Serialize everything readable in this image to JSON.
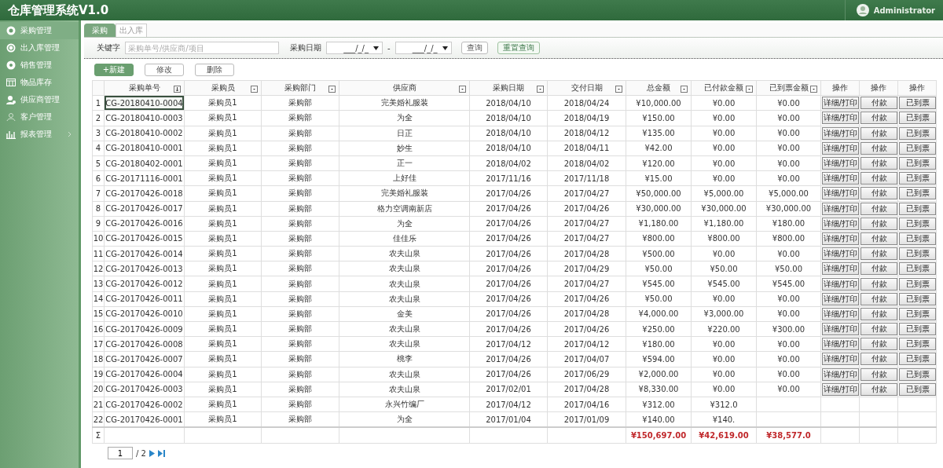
{
  "header": {
    "title": "仓库管理系统V1.0",
    "user": "Administrator"
  },
  "sidebar": {
    "items": [
      {
        "label": "采购管理",
        "selected": true
      },
      {
        "label": "出入库管理",
        "selected": false
      },
      {
        "label": "销售管理",
        "selected": false
      },
      {
        "label": "物品库存",
        "selected": false
      },
      {
        "label": "供应商管理",
        "selected": false
      },
      {
        "label": "客户管理",
        "selected": false
      },
      {
        "label": "报表管理",
        "selected": false,
        "expandable": true
      }
    ]
  },
  "tabs": [
    {
      "label": "采购",
      "selected": true
    },
    {
      "label": "出入库",
      "selected": false
    }
  ],
  "filters": {
    "keyword_label": "关键字",
    "keyword_placeholder": "采购单号/供应商/项目",
    "date_label": "采购日期",
    "date_from": "___/_/_",
    "separator": "-",
    "date_to": "___/_/_",
    "buttons": [
      "查询",
      "重置查询"
    ]
  },
  "toolbar": [
    {
      "label": "+新建",
      "kind": "primary"
    },
    {
      "label": "修改",
      "kind": "plain"
    },
    {
      "label": "删除",
      "kind": "plain"
    }
  ],
  "table": {
    "columns": [
      {
        "label": "采购单号",
        "kind": "sort"
      },
      {
        "label": "采购员",
        "kind": "filter"
      },
      {
        "label": "采购部门",
        "kind": "filter"
      },
      {
        "label": "供应商",
        "kind": "filter"
      },
      {
        "label": "采购日期",
        "kind": "filter"
      },
      {
        "label": "交付日期",
        "kind": "filter"
      },
      {
        "label": "总金额",
        "kind": "filter"
      },
      {
        "label": "已付款金额",
        "kind": "filter"
      },
      {
        "label": "已到票金额",
        "kind": "filter"
      },
      {
        "label": "操作",
        "kind": "plain"
      },
      {
        "label": "操作",
        "kind": "plain"
      },
      {
        "label": "操作",
        "kind": "plain"
      }
    ],
    "rows": [
      {
        "n": "1",
        "selected": true,
        "cells": [
          "CG-20180410-0004",
          "采购员1",
          "采购部",
          "完美婚礼服装",
          "2018/04/10",
          "2018/04/24",
          "¥10,000.00",
          "¥0.00",
          "¥0.00"
        ],
        "actions": [
          "详细/打印",
          "付款",
          "已到票"
        ]
      },
      {
        "n": "2",
        "selected": false,
        "cells": [
          "CG-20180410-0003",
          "采购员1",
          "采购部",
          "为全",
          "2018/04/10",
          "2018/04/19",
          "¥150.00",
          "¥0.00",
          "¥0.00"
        ],
        "actions": [
          "详细/打印",
          "付款",
          "已到票"
        ]
      },
      {
        "n": "3",
        "selected": false,
        "cells": [
          "CG-20180410-0002",
          "采购员1",
          "采购部",
          "日正",
          "2018/04/10",
          "2018/04/12",
          "¥135.00",
          "¥0.00",
          "¥0.00"
        ],
        "actions": [
          "详细/打印",
          "付款",
          "已到票"
        ]
      },
      {
        "n": "4",
        "selected": false,
        "cells": [
          "CG-20180410-0001",
          "采购员1",
          "采购部",
          "妙生",
          "2018/04/10",
          "2018/04/11",
          "¥42.00",
          "¥0.00",
          "¥0.00"
        ],
        "actions": [
          "详细/打印",
          "付款",
          "已到票"
        ]
      },
      {
        "n": "5",
        "selected": false,
        "cells": [
          "CG-20180402-0001",
          "采购员1",
          "采购部",
          "正一",
          "2018/04/02",
          "2018/04/02",
          "¥120.00",
          "¥0.00",
          "¥0.00"
        ],
        "actions": [
          "详细/打印",
          "付款",
          "已到票"
        ]
      },
      {
        "n": "6",
        "selected": false,
        "cells": [
          "CG-20171116-0001",
          "采购员1",
          "采购部",
          "上好佳",
          "2017/11/16",
          "2017/11/18",
          "¥15.00",
          "¥0.00",
          "¥0.00"
        ],
        "actions": [
          "详细/打印",
          "付款",
          "已到票"
        ]
      },
      {
        "n": "7",
        "selected": false,
        "cells": [
          "CG-20170426-0018",
          "采购员1",
          "采购部",
          "完美婚礼服装",
          "2017/04/26",
          "2017/04/27",
          "¥50,000.00",
          "¥5,000.00",
          "¥5,000.00"
        ],
        "actions": [
          "详细/打印",
          "付款",
          "已到票"
        ]
      },
      {
        "n": "8",
        "selected": false,
        "cells": [
          "CG-20170426-0017",
          "采购员1",
          "采购部",
          "格力空调南新店",
          "2017/04/26",
          "2017/04/26",
          "¥30,000.00",
          "¥30,000.00",
          "¥30,000.00"
        ],
        "actions": [
          "详细/打印",
          "付款",
          "已到票"
        ]
      },
      {
        "n": "9",
        "selected": false,
        "cells": [
          "CG-20170426-0016",
          "采购员1",
          "采购部",
          "为全",
          "2017/04/26",
          "2017/04/27",
          "¥1,180.00",
          "¥1,180.00",
          "¥180.00"
        ],
        "actions": [
          "详细/打印",
          "付款",
          "已到票"
        ]
      },
      {
        "n": "10",
        "selected": false,
        "cells": [
          "CG-20170426-0015",
          "采购员1",
          "采购部",
          "佳佳乐",
          "2017/04/26",
          "2017/04/27",
          "¥800.00",
          "¥800.00",
          "¥800.00"
        ],
        "actions": [
          "详细/打印",
          "付款",
          "已到票"
        ]
      },
      {
        "n": "11",
        "selected": false,
        "cells": [
          "CG-20170426-0014",
          "采购员1",
          "采购部",
          "农夫山泉",
          "2017/04/26",
          "2017/04/28",
          "¥500.00",
          "¥0.00",
          "¥0.00"
        ],
        "actions": [
          "详细/打印",
          "付款",
          "已到票"
        ]
      },
      {
        "n": "12",
        "selected": false,
        "cells": [
          "CG-20170426-0013",
          "采购员1",
          "采购部",
          "农夫山泉",
          "2017/04/26",
          "2017/04/29",
          "¥50.00",
          "¥50.00",
          "¥50.00"
        ],
        "actions": [
          "详细/打印",
          "付款",
          "已到票"
        ]
      },
      {
        "n": "13",
        "selected": false,
        "cells": [
          "CG-20170426-0012",
          "采购员1",
          "采购部",
          "农夫山泉",
          "2017/04/26",
          "2017/04/27",
          "¥545.00",
          "¥545.00",
          "¥545.00"
        ],
        "actions": [
          "详细/打印",
          "付款",
          "已到票"
        ]
      },
      {
        "n": "14",
        "selected": false,
        "cells": [
          "CG-20170426-0011",
          "采购员1",
          "采购部",
          "农夫山泉",
          "2017/04/26",
          "2017/04/26",
          "¥50.00",
          "¥0.00",
          "¥0.00"
        ],
        "actions": [
          "详细/打印",
          "付款",
          "已到票"
        ]
      },
      {
        "n": "15",
        "selected": false,
        "cells": [
          "CG-20170426-0010",
          "采购员1",
          "采购部",
          "金美",
          "2017/04/26",
          "2017/04/28",
          "¥4,000.00",
          "¥3,000.00",
          "¥0.00"
        ],
        "actions": [
          "详细/打印",
          "付款",
          "已到票"
        ]
      },
      {
        "n": "16",
        "selected": false,
        "cells": [
          "CG-20170426-0009",
          "采购员1",
          "采购部",
          "农夫山泉",
          "2017/04/26",
          "2017/04/26",
          "¥250.00",
          "¥220.00",
          "¥300.00"
        ],
        "actions": [
          "详细/打印",
          "付款",
          "已到票"
        ]
      },
      {
        "n": "17",
        "selected": false,
        "cells": [
          "CG-20170426-0008",
          "采购员1",
          "采购部",
          "农夫山泉",
          "2017/04/12",
          "2017/04/12",
          "¥180.00",
          "¥0.00",
          "¥0.00"
        ],
        "actions": [
          "详细/打印",
          "付款",
          "已到票"
        ]
      },
      {
        "n": "18",
        "selected": false,
        "cells": [
          "CG-20170426-0007",
          "采购员1",
          "采购部",
          "桃李",
          "2017/04/26",
          "2017/04/07",
          "¥594.00",
          "¥0.00",
          "¥0.00"
        ],
        "actions": [
          "详细/打印",
          "付款",
          "已到票"
        ]
      },
      {
        "n": "19",
        "selected": false,
        "cells": [
          "CG-20170426-0004",
          "采购员1",
          "采购部",
          "农夫山泉",
          "2017/04/26",
          "2017/06/29",
          "¥2,000.00",
          "¥0.00",
          "¥0.00"
        ],
        "actions": [
          "详细/打印",
          "付款",
          "已到票"
        ]
      },
      {
        "n": "20",
        "selected": false,
        "cells": [
          "CG-20170426-0003",
          "采购员1",
          "采购部",
          "农夫山泉",
          "2017/02/01",
          "2017/04/28",
          "¥8,330.00",
          "¥0.00",
          "¥0.00"
        ],
        "actions": [
          "详细/打印",
          "付款",
          "已到票"
        ]
      },
      {
        "n": "21",
        "selected": false,
        "cells": [
          "CG-20170426-0002",
          "采购员1",
          "采购部",
          "永兴竹编厂",
          "2017/04/12",
          "2017/04/16",
          "¥312.00",
          "¥312.0"
        ]
      },
      {
        "n": "22",
        "selected": false,
        "cells": [
          "CG-20170426-0001",
          "采购员1",
          "采购部",
          "为全",
          "2017/01/04",
          "2017/01/09",
          "¥140.00",
          "¥140."
        ]
      }
    ],
    "totals": {
      "symbol": "Σ",
      "values": [
        "¥150,697.00",
        "¥42,619.00",
        "¥38,577.0"
      ]
    }
  },
  "pager": {
    "page": "1",
    "of": "/ 2"
  }
}
